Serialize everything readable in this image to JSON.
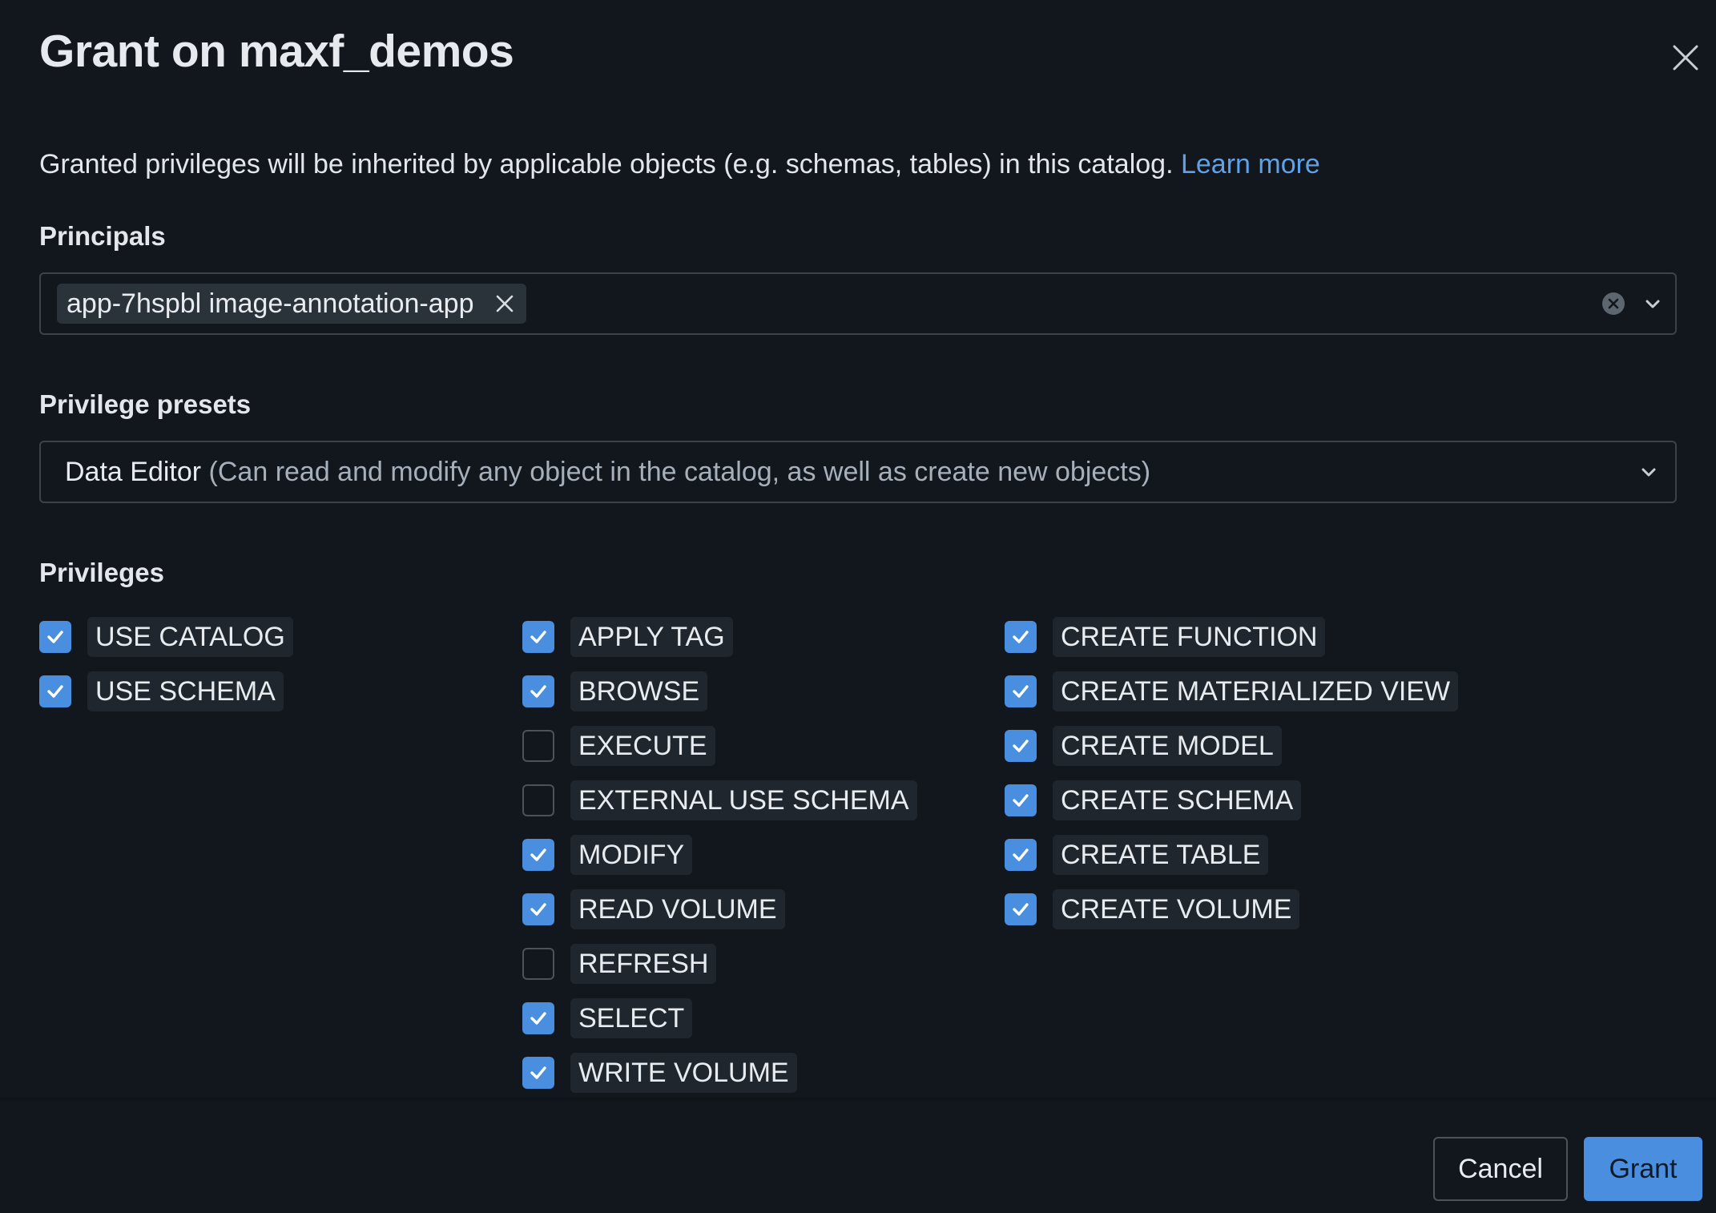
{
  "dialog": {
    "title": "Grant on maxf_demos",
    "description": "Granted privileges will be inherited by applicable objects (e.g. schemas, tables) in this catalog.",
    "learn_more": "Learn more"
  },
  "principals": {
    "label": "Principals",
    "chips": [
      "app-7hspbl image-annotation-app"
    ]
  },
  "presets": {
    "label": "Privilege presets",
    "selected_name": "Data Editor",
    "selected_desc": "(Can read and modify any object in the catalog, as well as create new objects)"
  },
  "privileges": {
    "label": "Privileges",
    "columns": [
      [
        {
          "name": "USE CATALOG",
          "checked": true
        },
        {
          "name": "USE SCHEMA",
          "checked": true
        }
      ],
      [
        {
          "name": "APPLY TAG",
          "checked": true
        },
        {
          "name": "BROWSE",
          "checked": true
        },
        {
          "name": "EXECUTE",
          "checked": false
        },
        {
          "name": "EXTERNAL USE SCHEMA",
          "checked": false
        },
        {
          "name": "MODIFY",
          "checked": true
        },
        {
          "name": "READ VOLUME",
          "checked": true
        },
        {
          "name": "REFRESH",
          "checked": false
        },
        {
          "name": "SELECT",
          "checked": true
        },
        {
          "name": "WRITE VOLUME",
          "checked": true
        }
      ],
      [
        {
          "name": "CREATE FUNCTION",
          "checked": true
        },
        {
          "name": "CREATE MATERIALIZED VIEW",
          "checked": true
        },
        {
          "name": "CREATE MODEL",
          "checked": true
        },
        {
          "name": "CREATE SCHEMA",
          "checked": true
        },
        {
          "name": "CREATE TABLE",
          "checked": true
        },
        {
          "name": "CREATE VOLUME",
          "checked": true
        }
      ]
    ]
  },
  "buttons": {
    "cancel": "Cancel",
    "grant": "Grant"
  },
  "colors": {
    "background": "#11171d",
    "accent": "#4a8fdf",
    "link": "#5fa2e9"
  }
}
